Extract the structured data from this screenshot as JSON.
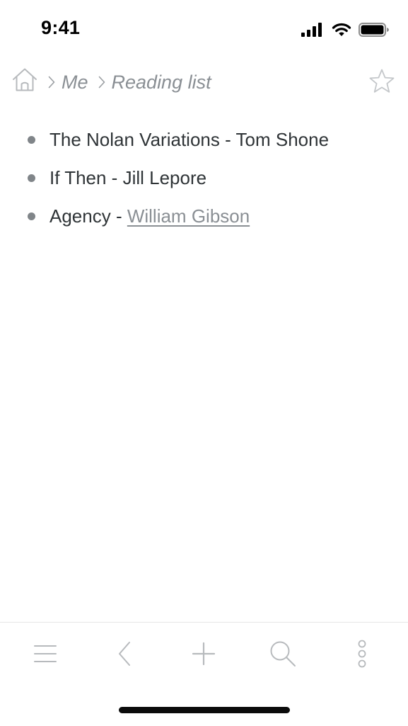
{
  "status_bar": {
    "time": "9:41",
    "signal_icon": "cellular-signal-icon",
    "wifi_icon": "wifi-icon",
    "battery_icon": "battery-icon"
  },
  "breadcrumb": {
    "home_icon": "home-icon",
    "separator_icon": "chevron-right-icon",
    "items": [
      {
        "label": "Me"
      },
      {
        "label": "Reading list"
      }
    ],
    "favorite_icon": "star-icon"
  },
  "reading_list": {
    "items": [
      {
        "text": "The Nolan Variations - Tom Shone"
      },
      {
        "text": "If Then - Jill Lepore"
      },
      {
        "prefix": "Agency - ",
        "link": "William Gibson"
      }
    ]
  },
  "toolbar": {
    "buttons": [
      {
        "icon": "menu-icon"
      },
      {
        "icon": "back-icon"
      },
      {
        "icon": "plus-icon"
      },
      {
        "icon": "search-icon"
      },
      {
        "icon": "more-vertical-icon"
      }
    ]
  },
  "colors": {
    "text": "#2f3437",
    "muted": "#8a8f94",
    "bullet": "#808589",
    "icon": "#b7babd"
  }
}
